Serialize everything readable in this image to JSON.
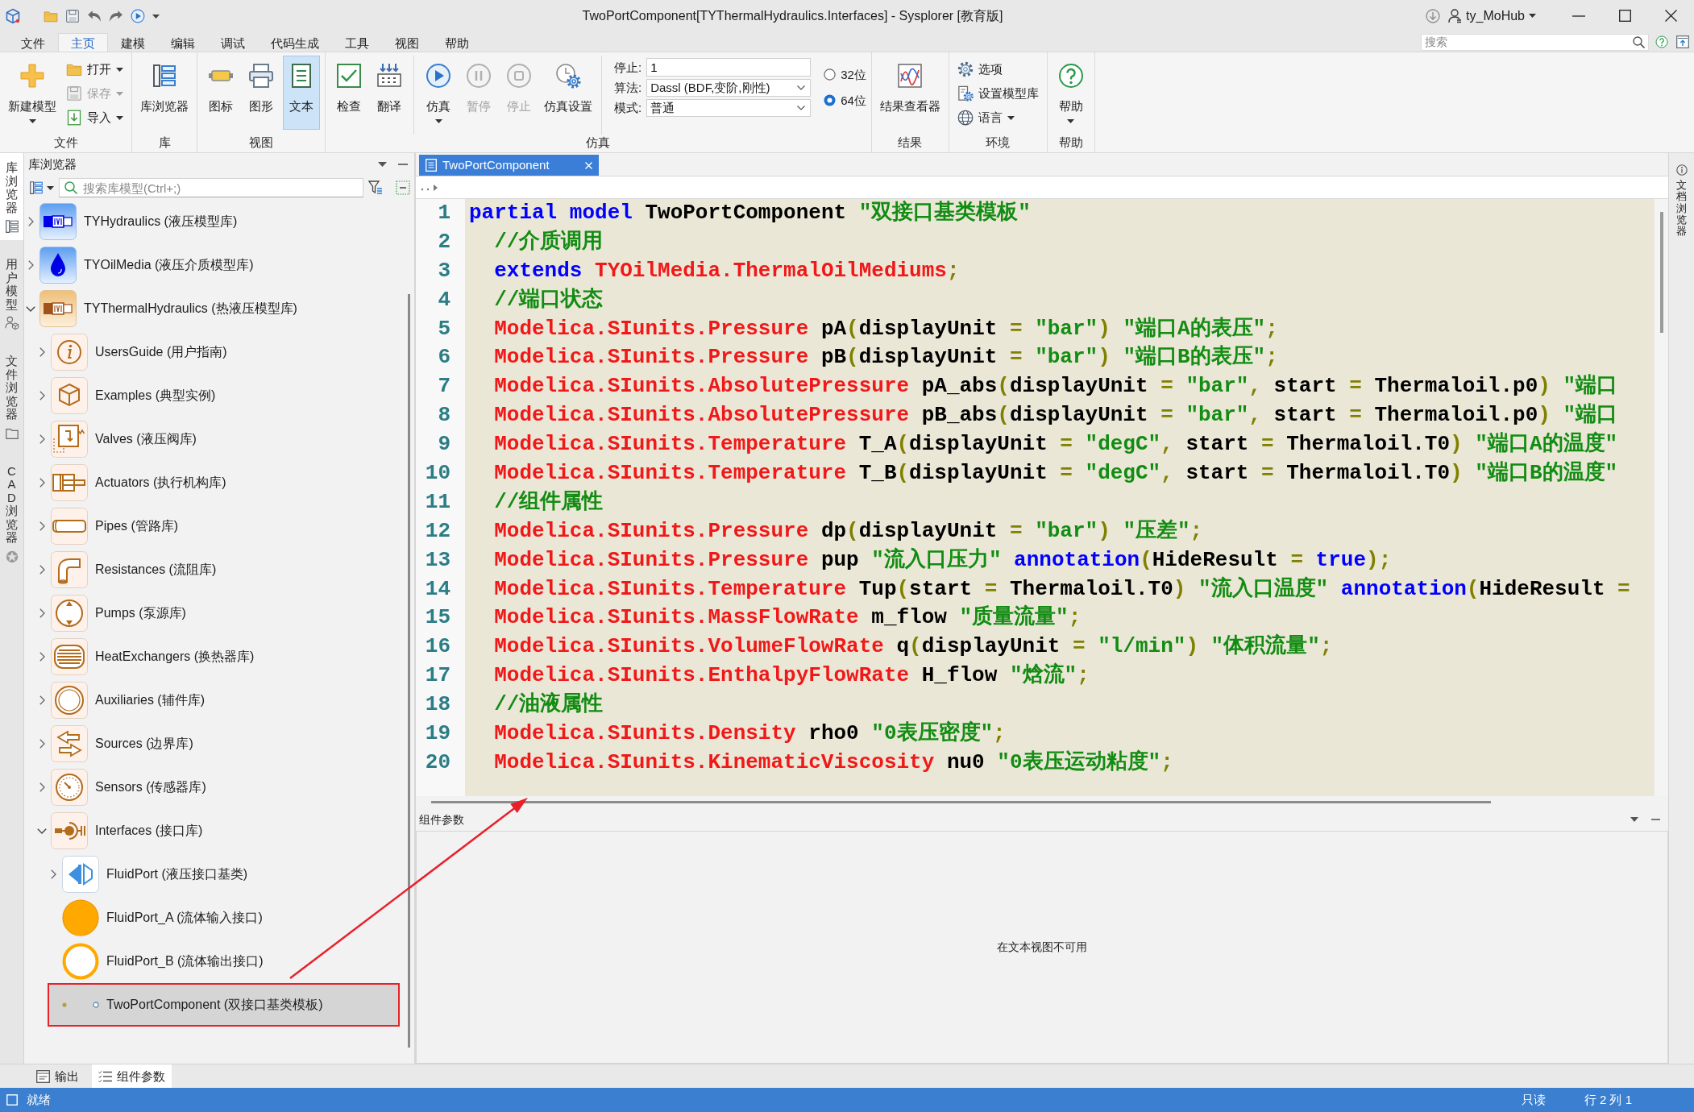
{
  "title_bar": {
    "title": "TwoPortComponent[TYThermalHydraulics.Interfaces] - Sysplorer [教育版]",
    "user": "ty_MoHub"
  },
  "menu_tabs": [
    {
      "label": "文件",
      "selected": false
    },
    {
      "label": "主页",
      "selected": true
    },
    {
      "label": "建模",
      "selected": false
    },
    {
      "label": "编辑",
      "selected": false
    },
    {
      "label": "调试",
      "selected": false
    },
    {
      "label": "代码生成",
      "selected": false
    },
    {
      "label": "工具",
      "selected": false
    },
    {
      "label": "视图",
      "selected": false
    },
    {
      "label": "帮助",
      "selected": false
    }
  ],
  "search": {
    "placeholder": "搜索"
  },
  "ribbon": {
    "groups": [
      {
        "label": "文件",
        "sections": [
          [
            {
              "kind": "large",
              "label": "新建模型",
              "dropdown": true,
              "disabled": false
            },
            {
              "kind": "small",
              "label": "打开",
              "dropdown": true,
              "disabled": false
            },
            {
              "kind": "small",
              "label": "保存",
              "dropdown": true,
              "disabled": true
            },
            {
              "kind": "small",
              "label": "导入",
              "dropdown": true,
              "disabled": false
            }
          ]
        ]
      },
      {
        "label": "库",
        "sections": [
          [
            {
              "kind": "large",
              "label": "库浏览器",
              "dropdown": false,
              "disabled": false
            }
          ]
        ]
      },
      {
        "label": "视图",
        "sections": [
          [
            {
              "kind": "large",
              "label": "图标",
              "dropdown": false,
              "disabled": false,
              "selected": false
            },
            {
              "kind": "large",
              "label": "图形",
              "dropdown": false,
              "disabled": false,
              "selected": false
            },
            {
              "kind": "large",
              "label": "文本",
              "dropdown": false,
              "disabled": false,
              "selected": true
            }
          ]
        ]
      },
      {
        "label": "仿真",
        "sections": [
          [
            {
              "kind": "large",
              "label": "检查",
              "dropdown": false,
              "disabled": false
            },
            {
              "kind": "large",
              "label": "翻译",
              "dropdown": false,
              "disabled": false
            }
          ],
          [
            {
              "kind": "large",
              "label": "仿真",
              "dropdown": true,
              "disabled": false
            },
            {
              "kind": "large",
              "label": "暂停",
              "dropdown": false,
              "disabled": true
            },
            {
              "kind": "large",
              "label": "停止",
              "dropdown": false,
              "disabled": true
            },
            {
              "kind": "large",
              "label": "仿真设置",
              "dropdown": false,
              "disabled": false
            }
          ],
          [
            {
              "kind": "input",
              "label": "停止:",
              "value": "1"
            },
            {
              "kind": "select",
              "label": "算法:",
              "value": "Dassl (BDF,变阶,刚性)"
            },
            {
              "kind": "select",
              "label": "模式:",
              "value": "普通"
            },
            {
              "kind": "radio",
              "label": "32位",
              "selected": false
            },
            {
              "kind": "radio",
              "label": "64位",
              "selected": true
            }
          ]
        ]
      },
      {
        "label": "结果",
        "sections": [
          [
            {
              "kind": "large",
              "label": "结果查看器",
              "dropdown": false,
              "disabled": false
            }
          ]
        ]
      },
      {
        "label": "环境",
        "sections": [
          [
            {
              "kind": "small",
              "label": "选项",
              "dropdown": false,
              "disabled": false
            },
            {
              "kind": "small",
              "label": "设置模型库",
              "dropdown": false,
              "disabled": false
            },
            {
              "kind": "small",
              "label": "语言",
              "dropdown": true,
              "disabled": false
            }
          ]
        ]
      },
      {
        "label": "帮助",
        "sections": [
          [
            {
              "kind": "large",
              "label": "帮助",
              "dropdown": true,
              "disabled": false
            }
          ]
        ]
      }
    ]
  },
  "side_tabs": [
    {
      "label": "库浏览器",
      "selected": true
    },
    {
      "label": "用户模型",
      "selected": false
    },
    {
      "label": "文件浏览器",
      "selected": false
    },
    {
      "label": "CAD 浏览器",
      "selected": false
    }
  ],
  "library_browser": {
    "title": "库浏览器",
    "search": {
      "placeholder": "搜索库模型(Ctrl+;)"
    },
    "tree": [
      {
        "label": "TYHydraulics (液压模型库)",
        "kind": "package",
        "expanded": false,
        "selected": false,
        "highlighted": false
      },
      {
        "label": "TYOilMedia (液压介质模型库)",
        "kind": "package",
        "expanded": false,
        "selected": false,
        "highlighted": false
      },
      {
        "label": "TYThermalHydraulics (热液压模型库)",
        "kind": "package",
        "expanded": true,
        "selected": false,
        "highlighted": false,
        "children": [
          {
            "label": "UsersGuide (用户指南)",
            "kind": "package",
            "expanded": false,
            "selected": false,
            "highlighted": false
          },
          {
            "label": "Examples (典型实例)",
            "kind": "package",
            "expanded": false,
            "selected": false,
            "highlighted": false
          },
          {
            "label": "Valves (液压阀库)",
            "kind": "package",
            "expanded": false,
            "selected": false,
            "highlighted": false
          },
          {
            "label": "Actuators (执行机构库)",
            "kind": "package",
            "expanded": false,
            "selected": false,
            "highlighted": false
          },
          {
            "label": "Pipes (管路库)",
            "kind": "package",
            "expanded": false,
            "selected": false,
            "highlighted": false
          },
          {
            "label": "Resistances (流阻库)",
            "kind": "package",
            "expanded": false,
            "selected": false,
            "highlighted": false
          },
          {
            "label": "Pumps (泵源库)",
            "kind": "package",
            "expanded": false,
            "selected": false,
            "highlighted": false
          },
          {
            "label": "HeatExchangers (换热器库)",
            "kind": "package",
            "expanded": false,
            "selected": false,
            "highlighted": false
          },
          {
            "label": "Auxiliaries (辅件库)",
            "kind": "package",
            "expanded": false,
            "selected": false,
            "highlighted": false
          },
          {
            "label": "Sources (边界库)",
            "kind": "package",
            "expanded": false,
            "selected": false,
            "highlighted": false
          },
          {
            "label": "Sensors (传感器库)",
            "kind": "package",
            "expanded": false,
            "selected": false,
            "highlighted": false
          },
          {
            "label": "Interfaces (接口库)",
            "kind": "package",
            "expanded": true,
            "selected": false,
            "highlighted": false,
            "children": [
              {
                "label": "FluidPort (液压接口基类)",
                "kind": "package",
                "expanded": false,
                "selected": false,
                "highlighted": false
              },
              {
                "label": "FluidPort_A (流体输入接口)",
                "kind": "class",
                "selected": false,
                "highlighted": false
              },
              {
                "label": "FluidPort_B (流体输出接口)",
                "kind": "class",
                "selected": false,
                "highlighted": false
              },
              {
                "label": "TwoPortComponent (双接口基类模板)",
                "kind": "class",
                "selected": true,
                "highlighted": true
              }
            ]
          }
        ]
      }
    ]
  },
  "editor": {
    "tabs": [
      {
        "label": "TwoPortComponent",
        "selected": true
      }
    ],
    "lines": [
      {
        "number": "1",
        "tokens": [
          {
            "kind": "kw",
            "text": "partial model"
          },
          {
            "kind": "id",
            "text": " TwoPortComponent "
          },
          {
            "kind": "str",
            "text": "\"双接口基类模板\""
          }
        ]
      },
      {
        "number": "2",
        "tokens": [
          {
            "kind": "cmt",
            "text": "  //介质调用"
          }
        ]
      },
      {
        "number": "3",
        "tokens": [
          {
            "kind": "kw",
            "text": "  extends"
          },
          {
            "kind": "type",
            "text": " TYOilMedia.ThermalOilMediums"
          },
          {
            "kind": "op",
            "text": ";"
          }
        ]
      },
      {
        "number": "4",
        "tokens": [
          {
            "kind": "cmt",
            "text": "  //端口状态"
          }
        ]
      },
      {
        "number": "5",
        "tokens": [
          {
            "kind": "type",
            "text": "  Modelica.SIunits.Pressure"
          },
          {
            "kind": "id",
            "text": " pA"
          },
          {
            "kind": "op",
            "text": "("
          },
          {
            "kind": "id",
            "text": "displayUnit"
          },
          {
            "kind": "op",
            "text": " = "
          },
          {
            "kind": "str",
            "text": "\"bar\""
          },
          {
            "kind": "op",
            "text": ") "
          },
          {
            "kind": "str",
            "text": "\"端口A的表压\""
          },
          {
            "kind": "op",
            "text": ";"
          }
        ]
      },
      {
        "number": "6",
        "tokens": [
          {
            "kind": "type",
            "text": "  Modelica.SIunits.Pressure"
          },
          {
            "kind": "id",
            "text": " pB"
          },
          {
            "kind": "op",
            "text": "("
          },
          {
            "kind": "id",
            "text": "displayUnit"
          },
          {
            "kind": "op",
            "text": " = "
          },
          {
            "kind": "str",
            "text": "\"bar\""
          },
          {
            "kind": "op",
            "text": ") "
          },
          {
            "kind": "str",
            "text": "\"端口B的表压\""
          },
          {
            "kind": "op",
            "text": ";"
          }
        ]
      },
      {
        "number": "7",
        "tokens": [
          {
            "kind": "type",
            "text": "  Modelica.SIunits.AbsolutePressure"
          },
          {
            "kind": "id",
            "text": " pA_abs"
          },
          {
            "kind": "op",
            "text": "("
          },
          {
            "kind": "id",
            "text": "displayUnit"
          },
          {
            "kind": "op",
            "text": " = "
          },
          {
            "kind": "str",
            "text": "\"bar\""
          },
          {
            "kind": "op",
            "text": ", "
          },
          {
            "kind": "id",
            "text": "start"
          },
          {
            "kind": "op",
            "text": " = "
          },
          {
            "kind": "id",
            "text": "Thermaloil.p0"
          },
          {
            "kind": "op",
            "text": ") "
          },
          {
            "kind": "str",
            "text": "\"端口"
          }
        ]
      },
      {
        "number": "8",
        "tokens": [
          {
            "kind": "type",
            "text": "  Modelica.SIunits.AbsolutePressure"
          },
          {
            "kind": "id",
            "text": " pB_abs"
          },
          {
            "kind": "op",
            "text": "("
          },
          {
            "kind": "id",
            "text": "displayUnit"
          },
          {
            "kind": "op",
            "text": " = "
          },
          {
            "kind": "str",
            "text": "\"bar\""
          },
          {
            "kind": "op",
            "text": ", "
          },
          {
            "kind": "id",
            "text": "start"
          },
          {
            "kind": "op",
            "text": " = "
          },
          {
            "kind": "id",
            "text": "Thermaloil.p0"
          },
          {
            "kind": "op",
            "text": ") "
          },
          {
            "kind": "str",
            "text": "\"端口"
          }
        ]
      },
      {
        "number": "9",
        "tokens": [
          {
            "kind": "type",
            "text": "  Modelica.SIunits.Temperature"
          },
          {
            "kind": "id",
            "text": " T_A"
          },
          {
            "kind": "op",
            "text": "("
          },
          {
            "kind": "id",
            "text": "displayUnit"
          },
          {
            "kind": "op",
            "text": " = "
          },
          {
            "kind": "str",
            "text": "\"degC\""
          },
          {
            "kind": "op",
            "text": ", "
          },
          {
            "kind": "id",
            "text": "start"
          },
          {
            "kind": "op",
            "text": " = "
          },
          {
            "kind": "id",
            "text": "Thermaloil.T0"
          },
          {
            "kind": "op",
            "text": ") "
          },
          {
            "kind": "str",
            "text": "\"端口A的温度\""
          }
        ]
      },
      {
        "number": "10",
        "tokens": [
          {
            "kind": "type",
            "text": "  Modelica.SIunits.Temperature"
          },
          {
            "kind": "id",
            "text": " T_B"
          },
          {
            "kind": "op",
            "text": "("
          },
          {
            "kind": "id",
            "text": "displayUnit"
          },
          {
            "kind": "op",
            "text": " = "
          },
          {
            "kind": "str",
            "text": "\"degC\""
          },
          {
            "kind": "op",
            "text": ", "
          },
          {
            "kind": "id",
            "text": "start"
          },
          {
            "kind": "op",
            "text": " = "
          },
          {
            "kind": "id",
            "text": "Thermaloil.T0"
          },
          {
            "kind": "op",
            "text": ") "
          },
          {
            "kind": "str",
            "text": "\"端口B的温度\""
          }
        ]
      },
      {
        "number": "11",
        "tokens": [
          {
            "kind": "cmt",
            "text": "  //组件属性"
          }
        ]
      },
      {
        "number": "12",
        "tokens": [
          {
            "kind": "type",
            "text": "  Modelica.SIunits.Pressure"
          },
          {
            "kind": "id",
            "text": " dp"
          },
          {
            "kind": "op",
            "text": "("
          },
          {
            "kind": "id",
            "text": "displayUnit"
          },
          {
            "kind": "op",
            "text": " = "
          },
          {
            "kind": "str",
            "text": "\"bar\""
          },
          {
            "kind": "op",
            "text": ") "
          },
          {
            "kind": "str",
            "text": "\"压差\""
          },
          {
            "kind": "op",
            "text": ";"
          }
        ]
      },
      {
        "number": "13",
        "tokens": [
          {
            "kind": "type",
            "text": "  Modelica.SIunits.Pressure"
          },
          {
            "kind": "id",
            "text": " pup "
          },
          {
            "kind": "str",
            "text": "\"流入口压力\""
          },
          {
            "kind": "kw",
            "text": " annotation"
          },
          {
            "kind": "op",
            "text": "("
          },
          {
            "kind": "id",
            "text": "HideResult"
          },
          {
            "kind": "op",
            "text": " = "
          },
          {
            "kind": "kw",
            "text": "true"
          },
          {
            "kind": "op",
            "text": ");"
          }
        ]
      },
      {
        "number": "14",
        "tokens": [
          {
            "kind": "type",
            "text": "  Modelica.SIunits.Temperature"
          },
          {
            "kind": "id",
            "text": " Tup"
          },
          {
            "kind": "op",
            "text": "("
          },
          {
            "kind": "id",
            "text": "start"
          },
          {
            "kind": "op",
            "text": " = "
          },
          {
            "kind": "id",
            "text": "Thermaloil.T0"
          },
          {
            "kind": "op",
            "text": ") "
          },
          {
            "kind": "str",
            "text": "\"流入口温度\""
          },
          {
            "kind": "kw",
            "text": " annotation"
          },
          {
            "kind": "op",
            "text": "("
          },
          {
            "kind": "id",
            "text": "HideResult"
          },
          {
            "kind": "op",
            "text": " ="
          }
        ]
      },
      {
        "number": "15",
        "tokens": [
          {
            "kind": "type",
            "text": "  Modelica.SIunits.MassFlowRate"
          },
          {
            "kind": "id",
            "text": " m_flow "
          },
          {
            "kind": "str",
            "text": "\"质量流量\""
          },
          {
            "kind": "op",
            "text": ";"
          }
        ]
      },
      {
        "number": "16",
        "tokens": [
          {
            "kind": "type",
            "text": "  Modelica.SIunits.VolumeFlowRate"
          },
          {
            "kind": "id",
            "text": " q"
          },
          {
            "kind": "op",
            "text": "("
          },
          {
            "kind": "id",
            "text": "displayUnit"
          },
          {
            "kind": "op",
            "text": " = "
          },
          {
            "kind": "str",
            "text": "\"l/min\""
          },
          {
            "kind": "op",
            "text": ") "
          },
          {
            "kind": "str",
            "text": "\"体积流量\""
          },
          {
            "kind": "op",
            "text": ";"
          }
        ]
      },
      {
        "number": "17",
        "tokens": [
          {
            "kind": "type",
            "text": "  Modelica.SIunits.EnthalpyFlowRate"
          },
          {
            "kind": "id",
            "text": " H_flow "
          },
          {
            "kind": "str",
            "text": "\"焓流\""
          },
          {
            "kind": "op",
            "text": ";"
          }
        ]
      },
      {
        "number": "18",
        "tokens": [
          {
            "kind": "cmt",
            "text": "  //油液属性"
          }
        ]
      },
      {
        "number": "19",
        "tokens": [
          {
            "kind": "type",
            "text": "  Modelica.SIunits.Density"
          },
          {
            "kind": "id",
            "text": " rho0 "
          },
          {
            "kind": "str",
            "text": "\"0表压密度\""
          },
          {
            "kind": "op",
            "text": ";"
          }
        ]
      },
      {
        "number": "20",
        "tokens": [
          {
            "kind": "type",
            "text": "  Modelica.SIunits.KinematicViscosity"
          },
          {
            "kind": "id",
            "text": " nu0 "
          },
          {
            "kind": "str",
            "text": "\"0表压运动粘度\""
          },
          {
            "kind": "op",
            "text": ";"
          }
        ]
      }
    ]
  },
  "component_panel": {
    "title": "组件参数",
    "message": "在文本视图不可用"
  },
  "right_tabs": [
    {
      "label": "文档浏览器"
    }
  ],
  "bottom_tabs": [
    {
      "label": "输出",
      "selected": false
    },
    {
      "label": "组件参数",
      "selected": true
    }
  ],
  "status_bar": {
    "text": "就绪",
    "indicators": [
      "只读",
      "行 2 列 1"
    ]
  },
  "annotation_arrow": true
}
